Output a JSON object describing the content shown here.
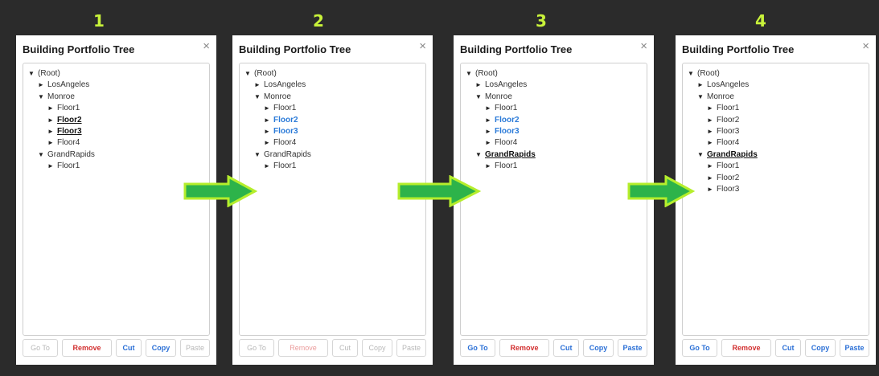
{
  "steps": [
    "1",
    "2",
    "3",
    "4"
  ],
  "panel_title": "Building Portfolio Tree",
  "close_glyph": "×",
  "panels": [
    {
      "tree": [
        {
          "label": "(Root)",
          "level": 0,
          "expanded": true,
          "style": "normal"
        },
        {
          "label": "LosAngeles",
          "level": 1,
          "expanded": false,
          "style": "normal"
        },
        {
          "label": "Monroe",
          "level": 1,
          "expanded": true,
          "style": "normal"
        },
        {
          "label": "Floor1",
          "level": 2,
          "expanded": false,
          "style": "normal"
        },
        {
          "label": "Floor2",
          "level": 2,
          "expanded": false,
          "style": "bold"
        },
        {
          "label": "Floor3",
          "level": 2,
          "expanded": false,
          "style": "bold"
        },
        {
          "label": "Floor4",
          "level": 2,
          "expanded": false,
          "style": "normal"
        },
        {
          "label": "GrandRapids",
          "level": 1,
          "expanded": true,
          "style": "normal"
        },
        {
          "label": "Floor1",
          "level": 2,
          "expanded": false,
          "style": "normal"
        }
      ],
      "buttons": [
        {
          "label": "Go To",
          "state": "disabled"
        },
        {
          "label": "Remove",
          "state": "red"
        },
        {
          "label": "Cut",
          "state": "blue"
        },
        {
          "label": "Copy",
          "state": "blue"
        },
        {
          "label": "Paste",
          "state": "disabled"
        }
      ]
    },
    {
      "tree": [
        {
          "label": "(Root)",
          "level": 0,
          "expanded": true,
          "style": "normal"
        },
        {
          "label": "LosAngeles",
          "level": 1,
          "expanded": false,
          "style": "normal"
        },
        {
          "label": "Monroe",
          "level": 1,
          "expanded": true,
          "style": "normal"
        },
        {
          "label": "Floor1",
          "level": 2,
          "expanded": false,
          "style": "normal"
        },
        {
          "label": "Floor2",
          "level": 2,
          "expanded": false,
          "style": "blue"
        },
        {
          "label": "Floor3",
          "level": 2,
          "expanded": false,
          "style": "blue"
        },
        {
          "label": "Floor4",
          "level": 2,
          "expanded": false,
          "style": "normal"
        },
        {
          "label": "GrandRapids",
          "level": 1,
          "expanded": true,
          "style": "normal"
        },
        {
          "label": "Floor1",
          "level": 2,
          "expanded": false,
          "style": "normal"
        }
      ],
      "buttons": [
        {
          "label": "Go To",
          "state": "disabled"
        },
        {
          "label": "Remove",
          "state": "red-disabled"
        },
        {
          "label": "Cut",
          "state": "disabled"
        },
        {
          "label": "Copy",
          "state": "disabled"
        },
        {
          "label": "Paste",
          "state": "disabled"
        }
      ]
    },
    {
      "tree": [
        {
          "label": "(Root)",
          "level": 0,
          "expanded": true,
          "style": "normal"
        },
        {
          "label": "LosAngeles",
          "level": 1,
          "expanded": false,
          "style": "normal"
        },
        {
          "label": "Monroe",
          "level": 1,
          "expanded": true,
          "style": "normal"
        },
        {
          "label": "Floor1",
          "level": 2,
          "expanded": false,
          "style": "normal"
        },
        {
          "label": "Floor2",
          "level": 2,
          "expanded": false,
          "style": "blue"
        },
        {
          "label": "Floor3",
          "level": 2,
          "expanded": false,
          "style": "blue"
        },
        {
          "label": "Floor4",
          "level": 2,
          "expanded": false,
          "style": "normal"
        },
        {
          "label": "GrandRapids",
          "level": 1,
          "expanded": true,
          "style": "bold"
        },
        {
          "label": "Floor1",
          "level": 2,
          "expanded": false,
          "style": "normal"
        }
      ],
      "buttons": [
        {
          "label": "Go To",
          "state": "blue"
        },
        {
          "label": "Remove",
          "state": "red"
        },
        {
          "label": "Cut",
          "state": "blue"
        },
        {
          "label": "Copy",
          "state": "blue"
        },
        {
          "label": "Paste",
          "state": "blue"
        }
      ]
    },
    {
      "tree": [
        {
          "label": "(Root)",
          "level": 0,
          "expanded": true,
          "style": "normal"
        },
        {
          "label": "LosAngeles",
          "level": 1,
          "expanded": false,
          "style": "normal"
        },
        {
          "label": "Monroe",
          "level": 1,
          "expanded": true,
          "style": "normal"
        },
        {
          "label": "Floor1",
          "level": 2,
          "expanded": false,
          "style": "normal"
        },
        {
          "label": "Floor2",
          "level": 2,
          "expanded": false,
          "style": "normal"
        },
        {
          "label": "Floor3",
          "level": 2,
          "expanded": false,
          "style": "normal"
        },
        {
          "label": "Floor4",
          "level": 2,
          "expanded": false,
          "style": "normal"
        },
        {
          "label": "GrandRapids",
          "level": 1,
          "expanded": true,
          "style": "bold"
        },
        {
          "label": "Floor1",
          "level": 2,
          "expanded": false,
          "style": "normal"
        },
        {
          "label": "Floor2",
          "level": 2,
          "expanded": false,
          "style": "normal"
        },
        {
          "label": "Floor3",
          "level": 2,
          "expanded": false,
          "style": "normal"
        }
      ],
      "buttons": [
        {
          "label": "Go To",
          "state": "blue"
        },
        {
          "label": "Remove",
          "state": "red"
        },
        {
          "label": "Cut",
          "state": "blue"
        },
        {
          "label": "Copy",
          "state": "blue"
        },
        {
          "label": "Paste",
          "state": "blue"
        }
      ]
    }
  ],
  "colors": {
    "background": "#2b2b2b",
    "step_number": "#c8f23a",
    "arrow_fill": "#2db34a",
    "arrow_outline": "#b5ee2c",
    "selected_blue": "#2a7ad8",
    "remove_red": "#d23030"
  }
}
